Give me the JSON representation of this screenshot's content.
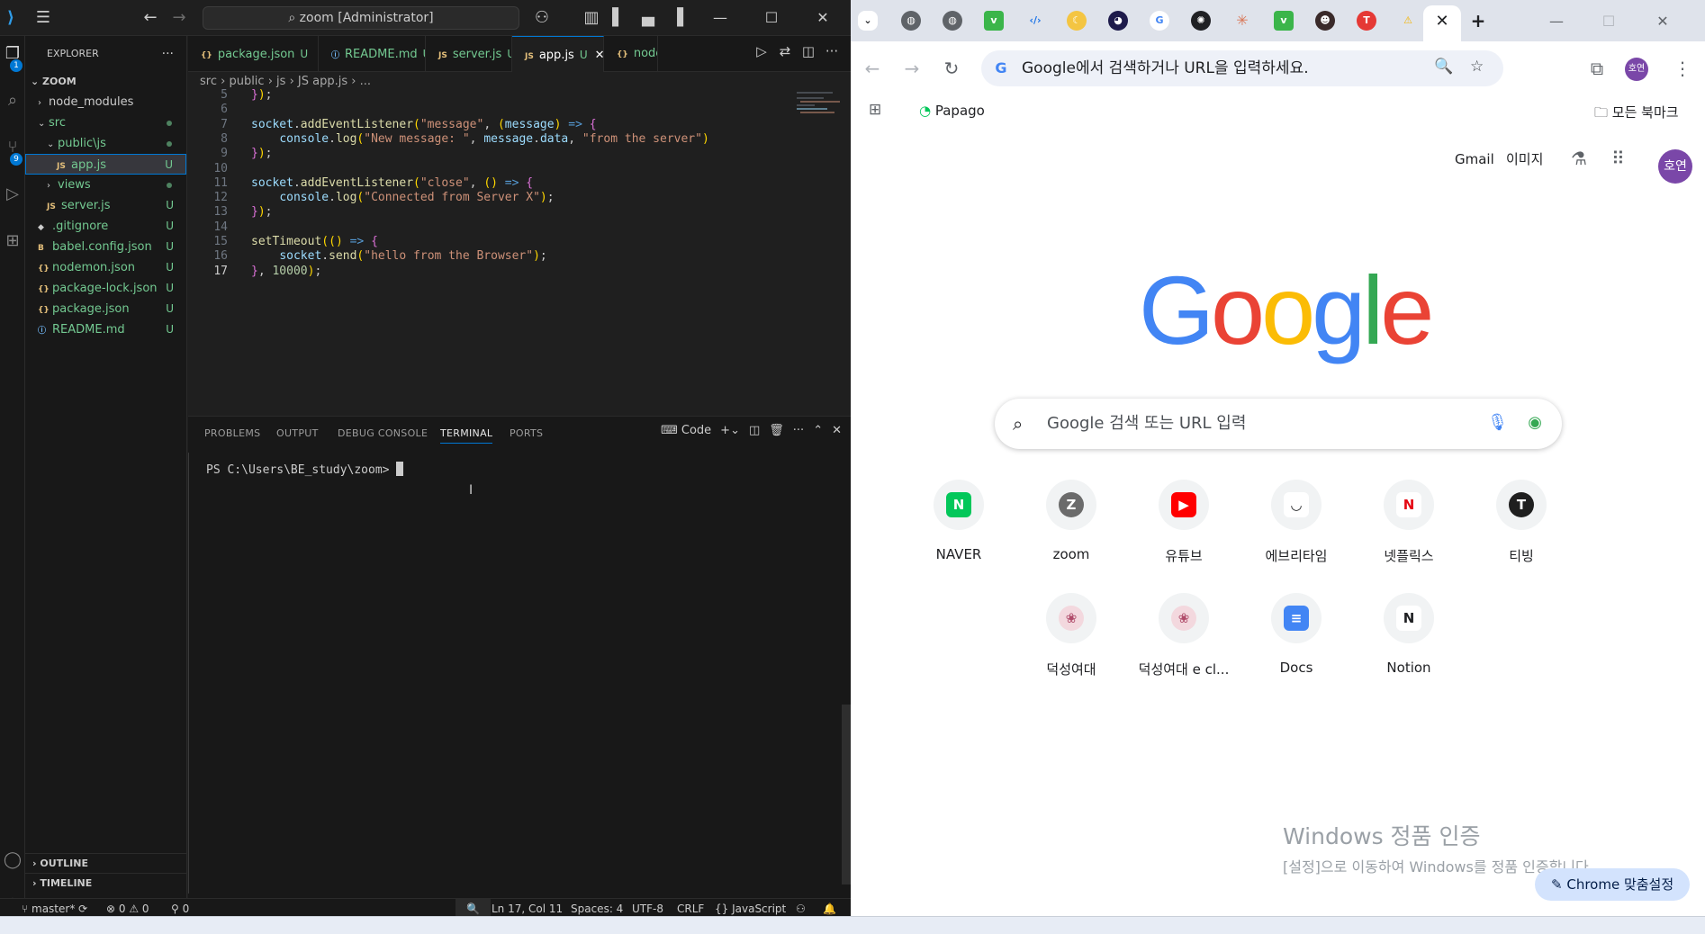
{
  "vscode": {
    "title": {
      "search_text": "zoom [Administrator]"
    },
    "explorer": {
      "header": "EXPLORER",
      "folder": "ZOOM",
      "items": [
        {
          "label": "node_modules",
          "indent": 1,
          "chev": "›",
          "type": "folder",
          "status": ""
        },
        {
          "label": "src",
          "indent": 1,
          "chev": "⌄",
          "type": "folder",
          "status": "dot"
        },
        {
          "label": "public\\js",
          "indent": 2,
          "chev": "⌄",
          "type": "folder",
          "status": "dot"
        },
        {
          "label": "app.js",
          "indent": 3,
          "chev": "",
          "type": "js",
          "status": "U",
          "selected": true
        },
        {
          "label": "views",
          "indent": 2,
          "chev": "›",
          "type": "folder",
          "status": "dot"
        },
        {
          "label": "server.js",
          "indent": 2,
          "chev": "",
          "type": "js",
          "status": "U"
        },
        {
          "label": ".gitignore",
          "indent": 1,
          "chev": "",
          "type": "git",
          "status": "U"
        },
        {
          "label": "babel.config.json",
          "indent": 1,
          "chev": "",
          "type": "babel",
          "status": "U"
        },
        {
          "label": "nodemon.json",
          "indent": 1,
          "chev": "",
          "type": "json",
          "status": "U"
        },
        {
          "label": "package-lock.json",
          "indent": 1,
          "chev": "",
          "type": "json",
          "status": "U"
        },
        {
          "label": "package.json",
          "indent": 1,
          "chev": "",
          "type": "json",
          "status": "U"
        },
        {
          "label": "README.md",
          "indent": 1,
          "chev": "",
          "type": "info",
          "status": "U"
        }
      ],
      "outline": "OUTLINE",
      "timeline": "TIMELINE"
    },
    "tabs": [
      {
        "icon": "{}",
        "label": "package.json",
        "status": "U"
      },
      {
        "icon": "ⓘ",
        "label": "README.md",
        "status": "U●"
      },
      {
        "icon": "JS",
        "label": "server.js",
        "status": "U"
      },
      {
        "icon": "JS",
        "label": "app.js",
        "status": "U",
        "active": true
      },
      {
        "icon": "{}",
        "label": "node",
        "status": ""
      }
    ],
    "breadcrumb": [
      "src",
      "public",
      "js",
      "JS app.js",
      "..."
    ],
    "code": [
      {
        "n": "5",
        "text": "});"
      },
      {
        "n": "6",
        "text": ""
      },
      {
        "n": "7",
        "text": "socket.addEventListener(\"message\", (message) => {"
      },
      {
        "n": "8",
        "text": "    console.log(\"New message: \", message.data, \"from the server\")"
      },
      {
        "n": "9",
        "text": "});"
      },
      {
        "n": "10",
        "text": ""
      },
      {
        "n": "11",
        "text": "socket.addEventListener(\"close\", () => {"
      },
      {
        "n": "12",
        "text": "    console.log(\"Connected from Server X\");"
      },
      {
        "n": "13",
        "text": "});"
      },
      {
        "n": "14",
        "text": ""
      },
      {
        "n": "15",
        "text": "setTimeout(() => {"
      },
      {
        "n": "16",
        "text": "    socket.send(\"hello from the Browser\");"
      },
      {
        "n": "17",
        "text": "}, 10000);"
      }
    ],
    "panel": {
      "tabs": [
        "PROBLEMS",
        "OUTPUT",
        "DEBUG CONSOLE",
        "TERMINAL",
        "PORTS"
      ],
      "active_tab": "TERMINAL",
      "terminal_label": "Code",
      "prompt": "PS C:\\Users\\BE_study\\zoom> "
    },
    "status": {
      "branch": "master*",
      "errors": "0",
      "warnings": "0",
      "ports": "0",
      "position": "Ln 17, Col 11",
      "spaces": "Spaces: 4",
      "encoding": "UTF-8",
      "eol": "CRLF",
      "language": "JavaScript"
    },
    "badges": {
      "explorer": "1",
      "scm": "9"
    }
  },
  "chrome": {
    "omnibox_text": "Google에서 검색하거나 URL을 입력하세요.",
    "bookmarks": {
      "papago": "Papago",
      "all": "모든 북마크"
    },
    "header": {
      "gmail": "Gmail",
      "images": "이미지",
      "avatar": "호연"
    },
    "profile_avatar": "호연",
    "search_placeholder": "Google 검색 또는 URL 입력",
    "shortcuts": [
      {
        "label": "NAVER",
        "glyph": "N",
        "color": "#03c75a"
      },
      {
        "label": "zoom",
        "glyph": "Z",
        "color": "#6b6b6b"
      },
      {
        "label": "유튜브",
        "glyph": "▶",
        "color": "#ff0000"
      },
      {
        "label": "에브리타임",
        "glyph": "◡",
        "color": "#ffffff"
      },
      {
        "label": "넷플릭스",
        "glyph": "N",
        "color": "#ffffff"
      },
      {
        "label": "티빙",
        "glyph": "T",
        "color": "#1f1f1f"
      },
      {
        "label": "덕성여대",
        "glyph": "❀",
        "color": "#f3d8de"
      },
      {
        "label": "덕성여대 e cl...",
        "glyph": "❀",
        "color": "#f3d8de"
      },
      {
        "label": "Docs",
        "glyph": "≡",
        "color": "#4285f4"
      },
      {
        "label": "Notion",
        "glyph": "N",
        "color": "#ffffff"
      }
    ],
    "activate_title": "Windows 정품 인증",
    "activate_sub": "[설정]으로 이동하여 Windows를 정품 인증합니다.",
    "customize": "Chrome 맞춤설정"
  }
}
